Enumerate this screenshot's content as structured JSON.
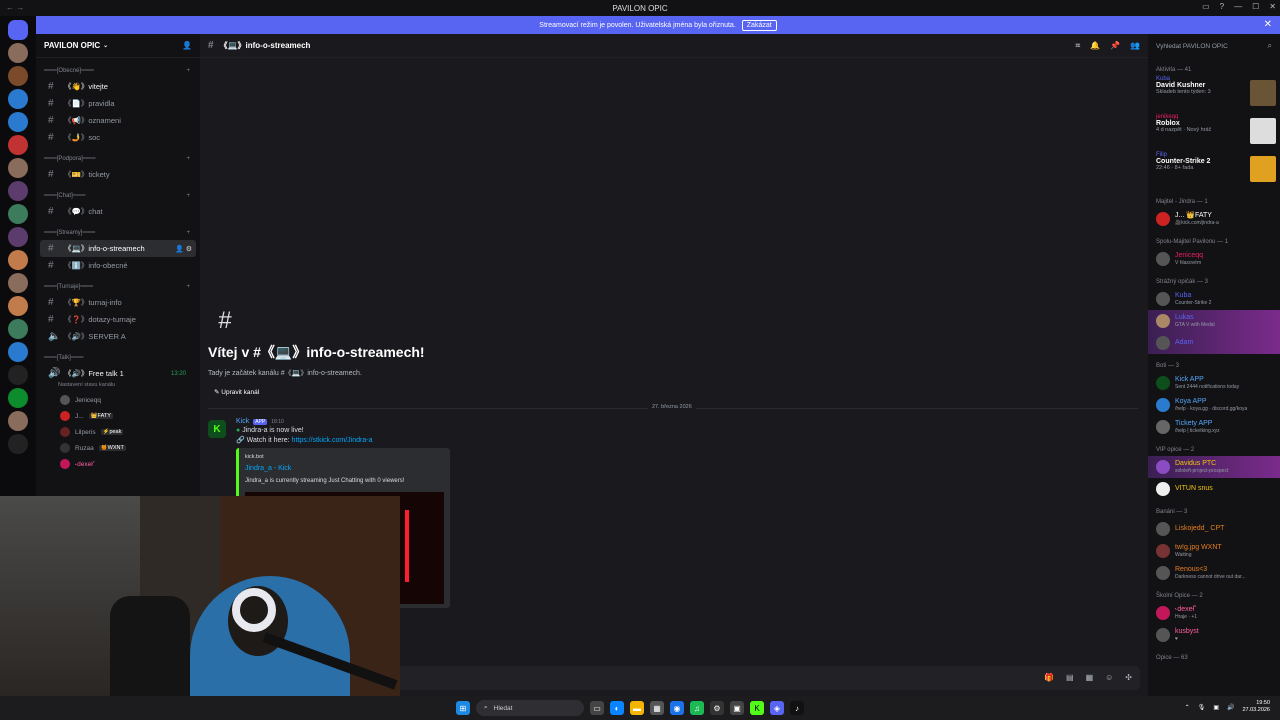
{
  "window": {
    "title": "PAVILON OPIC"
  },
  "banner": {
    "text": "Streamovací režim je povolen. Uživatelská jména byla ořiznuta.",
    "button": "Zakázat"
  },
  "guild": {
    "name": "PAVILON OPIC"
  },
  "categories": [
    {
      "name": "═══[Obecné]═══",
      "channels": [
        "《👋》vitejte",
        "《📄》pravidla",
        "《📢》oznameni",
        "《🤳》soc"
      ]
    },
    {
      "name": "═══[Podpora]═══",
      "channels": [
        "《🎫》tickety"
      ]
    },
    {
      "name": "═══[Chat]═══",
      "channels": [
        "《💬》chat"
      ]
    },
    {
      "name": "═══[Streamy]═══",
      "channels": [
        "《💻》info-o-streamech",
        "《ℹ️》info-obecné"
      ]
    },
    {
      "name": "═══[Turnaje]═══",
      "channels": [
        "《🏆》turnaj-info",
        "《❓》dotazy-turnaje",
        "《🔊》SERVER A"
      ]
    },
    {
      "name": "═══[Talk]═══",
      "channels": [
        "《🔊》Free talk 1"
      ]
    }
  ],
  "voice": {
    "status": "Nastavení stavu kanálu",
    "time": "13:20",
    "users": [
      {
        "name": "Jeniceqq",
        "tag": ""
      },
      {
        "name": "J...",
        "tag": "👑FATY"
      },
      {
        "name": "Lilperis",
        "tag": "⚡peak"
      },
      {
        "name": "Ruzaa",
        "tag": "🍯WXNT"
      },
      {
        "name": "˞dexeł˚",
        "tag": ""
      }
    ]
  },
  "header": {
    "channel": "《💻》info-o-streamech"
  },
  "welcome": {
    "title": "Vítej v #《💻》info-o-streamech!",
    "subtitle": "Tady je začátek kanálu #《💻》info-o-streamech.",
    "edit": "Upravit kanál"
  },
  "date_sep": "27. března 2026",
  "message": {
    "author": "Kick",
    "badge": "APP",
    "time": "18:10",
    "line1": "Jindra-a is now live!",
    "line2_prefix": "Watch it here: ",
    "line2_link": "https://stkick.com/Jindra-a",
    "embed_source": "kick.bot",
    "embed_title": "Jindra_a - Kick",
    "embed_desc": "Jindra_a is currently streaming Just Chatting with 0 viewers!"
  },
  "members": {
    "search_placeholder": "Vyhledat PAVILON OPIC",
    "activity_header": "Aktivita — 41",
    "activities": [
      {
        "user": "Kuba",
        "title": "David Kushner",
        "sub": "Skladeb tento týden: 3"
      },
      {
        "user": "jenikeqq",
        "title": "Roblox",
        "sub": "4 d nazpět · Nový hráč"
      },
      {
        "user": "Filip",
        "title": "Counter-Strike 2",
        "sub": "22:46 · 8+ řada"
      }
    ],
    "groups": [
      {
        "header": "Majitel - Jindra — 1",
        "members": [
          {
            "name": "J... 👑FATY",
            "status": "🎥kick.com/jindra-a"
          }
        ]
      },
      {
        "header": "Spolu-Majitel Pavilonu — 1",
        "members": [
          {
            "name": "Jeniceqq",
            "status": "V hlasovém"
          }
        ]
      },
      {
        "header": "Strážný opičák — 3",
        "members": [
          {
            "name": "Kuba",
            "status": "Counter-Strike 2"
          },
          {
            "name": "Lukas",
            "status": "GTA V with Medal"
          },
          {
            "name": "Adam",
            "status": ""
          }
        ]
      },
      {
        "header": "Boti — 3",
        "members": [
          {
            "name": "Kick APP",
            "status": "Sent 2444 notifications today"
          },
          {
            "name": "Koya APP",
            "status": "/help · koya.gg · discord.gg/koya"
          },
          {
            "name": "Tickety APP",
            "status": "/help | ticketking.xyz"
          }
        ]
      },
      {
        "header": "VIP opice — 2",
        "members": [
          {
            "name": "Davidus PTC",
            "status": "sololeft-project-prospect"
          },
          {
            "name": "VITUN snus",
            "status": ""
          }
        ]
      },
      {
        "header": "Banáni — 3",
        "members": [
          {
            "name": "Liskojedd_ CPT",
            "status": ""
          },
          {
            "name": "tw!g.jpg WXNT",
            "status": "Waiting"
          },
          {
            "name": "Renous<3",
            "status": "Darkness cannot drive out dar..."
          }
        ]
      },
      {
        "header": "Školní Opice — 2",
        "members": [
          {
            "name": "˞dexeł˚",
            "status": "Hraje · +1"
          },
          {
            "name": "kusbyst",
            "status": "♥"
          }
        ]
      },
      {
        "header": "Opice — 63",
        "members": []
      }
    ]
  },
  "taskbar": {
    "search": "Hledat",
    "time": "19:50",
    "date": "27.03.2026"
  }
}
